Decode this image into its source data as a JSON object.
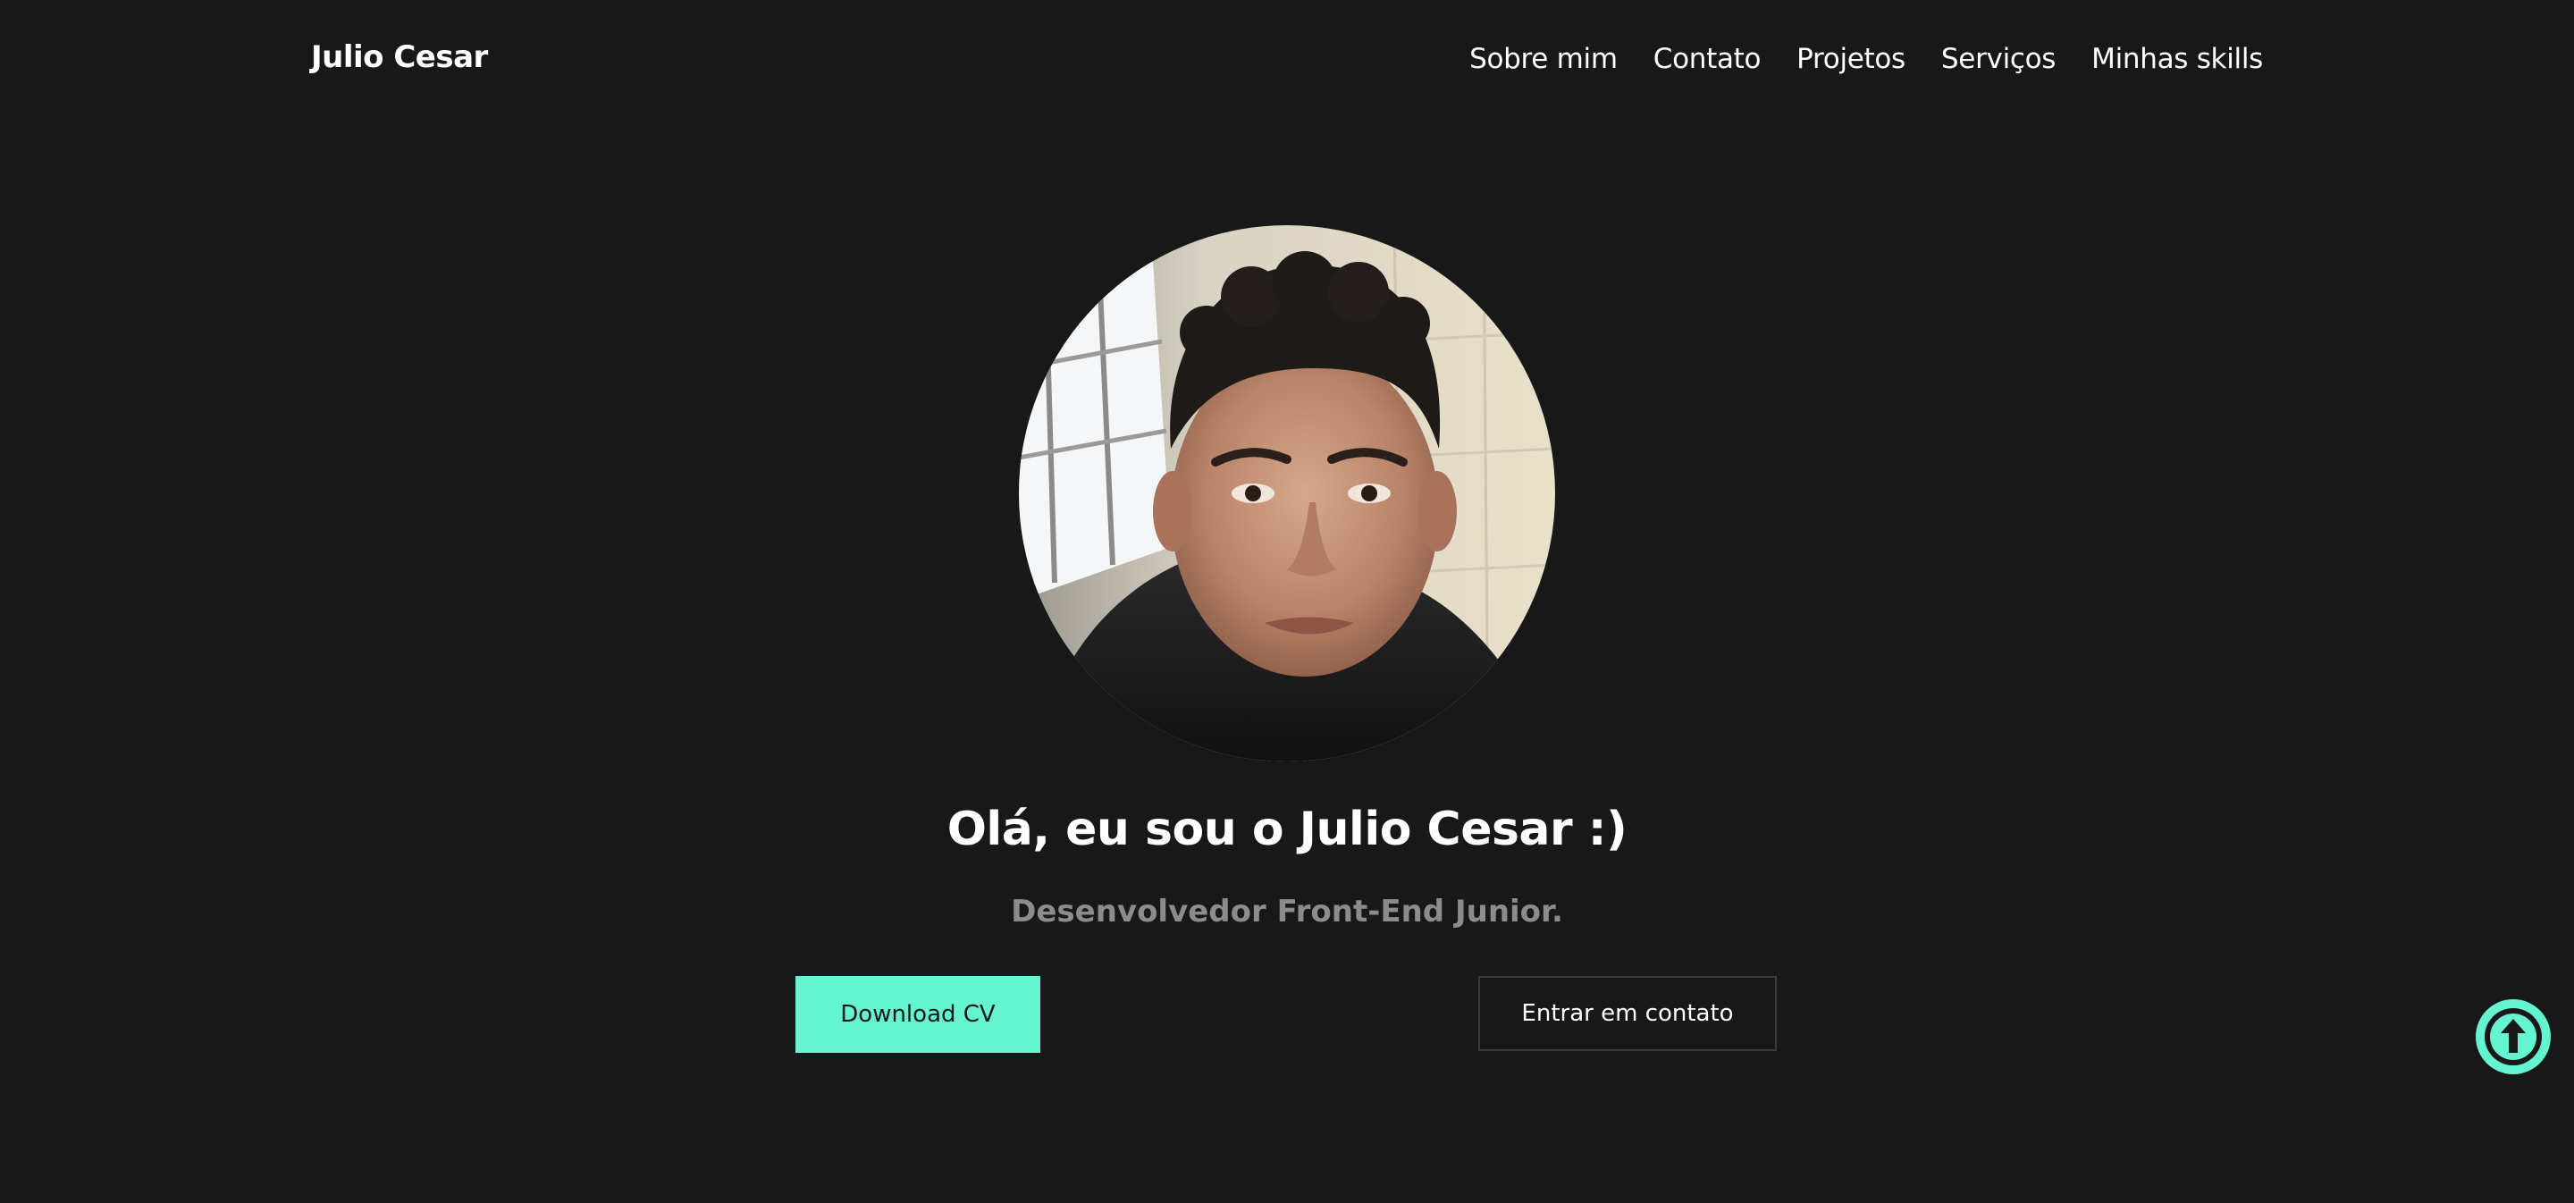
{
  "header": {
    "brand": "Julio Cesar",
    "nav": [
      "Sobre mim",
      "Contato",
      "Projetos",
      "Serviços",
      "Minhas skills"
    ]
  },
  "hero": {
    "headline": "Olá, eu sou o Julio Cesar :)",
    "subtitle": "Desenvolvedor Front-End Junior.",
    "primary_button": "Download CV",
    "secondary_button": "Entrar em contato"
  },
  "colors": {
    "background": "#181818",
    "accent": "#64f4d0",
    "text": "#ffffff",
    "muted": "#8c8c8c"
  },
  "icons": {
    "scroll_top": "arrow-up-circle-icon"
  }
}
